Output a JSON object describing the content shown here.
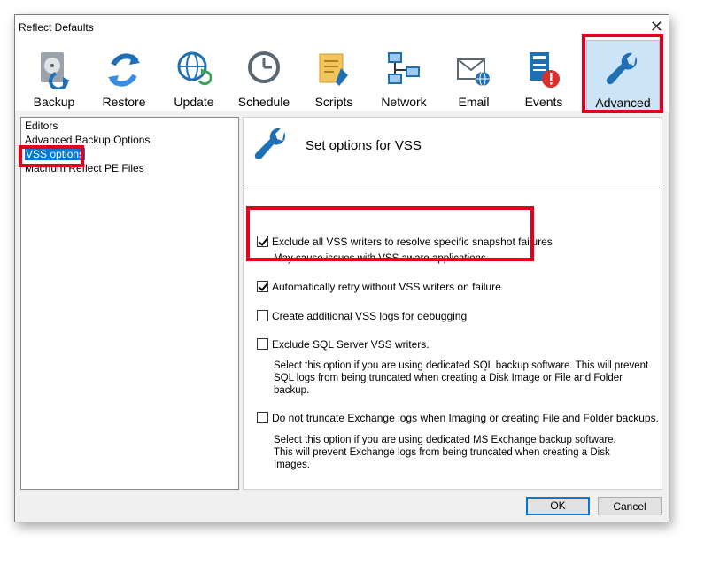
{
  "window": {
    "title": "Reflect Defaults"
  },
  "toolbar": {
    "items": [
      {
        "label": "Backup",
        "icon": "backup-icon"
      },
      {
        "label": "Restore",
        "icon": "restore-icon"
      },
      {
        "label": "Update",
        "icon": "update-icon"
      },
      {
        "label": "Schedule",
        "icon": "schedule-icon"
      },
      {
        "label": "Scripts",
        "icon": "scripts-icon"
      },
      {
        "label": "Network",
        "icon": "network-icon"
      },
      {
        "label": "Email",
        "icon": "email-icon"
      },
      {
        "label": "Events",
        "icon": "events-icon"
      },
      {
        "label": "Advanced",
        "icon": "wrench-icon",
        "selected": true
      }
    ]
  },
  "tree": {
    "items": [
      {
        "label": "Editors"
      },
      {
        "label": "Advanced Backup Options"
      },
      {
        "label": "VSS options",
        "selected": true
      },
      {
        "label": "Macrium Reflect PE Files"
      }
    ]
  },
  "panel": {
    "heading": "Set options for VSS",
    "options": [
      {
        "label": "Exclude all VSS writers to resolve specific snapshot failures",
        "checked": true,
        "description": "May cause issues with VSS aware applications"
      },
      {
        "label": "Automatically retry without VSS writers on failure",
        "checked": true
      },
      {
        "label": "Create additional VSS logs for debugging",
        "checked": false
      },
      {
        "label": "Exclude SQL Server VSS writers.",
        "checked": false,
        "description_lines": [
          "Select this option if you are using dedicated SQL backup software. This will prevent",
          "SQL logs from being truncated when creating a Disk Image or File and Folder",
          "backup."
        ]
      },
      {
        "label": "Do not truncate Exchange logs when Imaging or creating File and Folder backups.",
        "checked": false,
        "description_lines": [
          "Select this option if you are using dedicated MS Exchange backup software.",
          "This will prevent Exchange  logs from being truncated when creating a Disk",
          "Images."
        ]
      }
    ]
  },
  "buttons": {
    "ok": "OK",
    "cancel": "Cancel"
  },
  "colors": {
    "highlight": "#e2001a",
    "accent": "#0078d7",
    "icon_blue": "#1f6fb5"
  }
}
